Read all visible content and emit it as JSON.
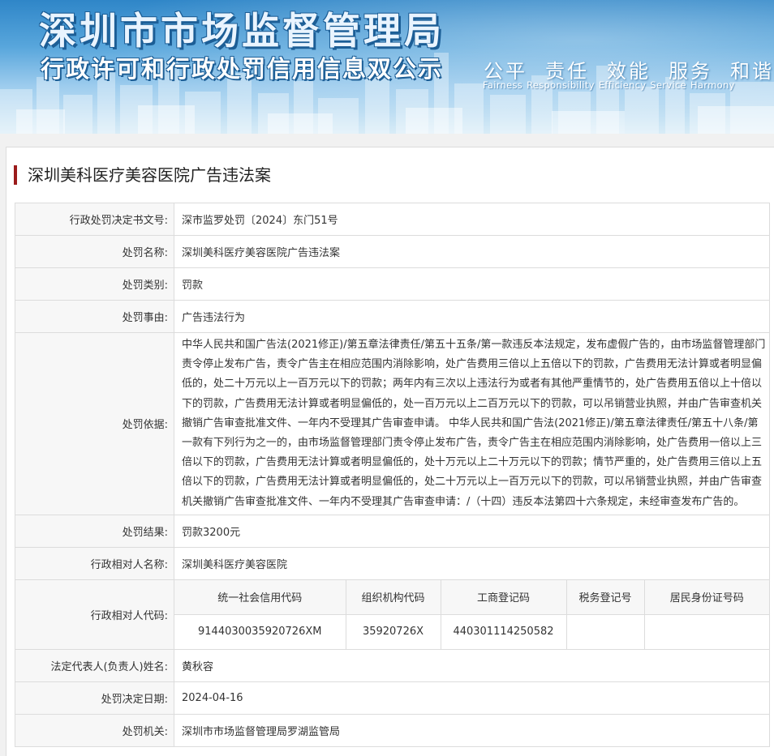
{
  "banner": {
    "title": "深圳市市场监督管理局",
    "subtitle": "行政许可和行政处罚信用信息双公示",
    "slogan_cn": [
      "公平",
      "责任",
      "效能",
      "服务",
      "和谐"
    ],
    "slogan_en": [
      "Fairness",
      "Responsibility",
      "Efficiency",
      "Service",
      "Harmony"
    ]
  },
  "case_title": "深圳美科医疗美容医院广告违法案",
  "fields": {
    "decision_no": {
      "label": "行政处罚决定书文号:",
      "value": "深市监罗处罚〔2024〕东门51号"
    },
    "case_name": {
      "label": "处罚名称:",
      "value": "深圳美科医疗美容医院广告违法案"
    },
    "category": {
      "label": "处罚类别:",
      "value": "罚款"
    },
    "reason": {
      "label": "处罚事由:",
      "value": "广告违法行为"
    },
    "basis": {
      "label": "处罚依据:",
      "value": "中华人民共和国广告法(2021修正)/第五章法律责任/第五十五条/第一款违反本法规定，发布虚假广告的，由市场监督管理部门责令停止发布广告，责令广告主在相应范围内消除影响，处广告费用三倍以上五倍以下的罚款，广告费用无法计算或者明显偏低的，处二十万元以上一百万元以下的罚款；两年内有三次以上违法行为或者有其他严重情节的，处广告费用五倍以上十倍以下的罚款，广告费用无法计算或者明显偏低的，处一百万元以上二百万元以下的罚款，可以吊销营业执照，并由广告审查机关撤销广告审查批准文件、一年内不受理其广告审查申请。 中华人民共和国广告法(2021修正)/第五章法律责任/第五十八条/第一款有下列行为之一的，由市场监督管理部门责令停止发布广告，责令广告主在相应范围内消除影响，处广告费用一倍以上三倍以下的罚款，广告费用无法计算或者明显偏低的，处十万元以上二十万元以下的罚款；情节严重的，处广告费用三倍以上五倍以下的罚款，广告费用无法计算或者明显偏低的，处二十万元以上一百万元以下的罚款，可以吊销营业执照，并由广告审查机关撤销广告审查批准文件、一年内不受理其广告审查申请：/（十四）违反本法第四十六条规定，未经审查发布广告的。"
    },
    "result": {
      "label": "处罚结果:",
      "value": "罚款3200元"
    },
    "party_name": {
      "label": "行政相对人名称:",
      "value": "深圳美科医疗美容医院"
    },
    "party_code": {
      "label": "行政相对人代码:",
      "columns": [
        "统一社会信用代码",
        "组织机构代码",
        "工商登记码",
        "税务登记号",
        "居民身份证号码"
      ],
      "values": [
        "9144030035920726XM",
        "35920726X",
        "440301114250582",
        "",
        ""
      ]
    },
    "legal_rep": {
      "label": "法定代表人(负责人)姓名:",
      "value": "黄秋容"
    },
    "decision_date": {
      "label": "处罚决定日期:",
      "value": "2024-04-16"
    },
    "authority": {
      "label": "处罚机关:",
      "value": "深圳市市场监督管理局罗湖监管局"
    }
  }
}
